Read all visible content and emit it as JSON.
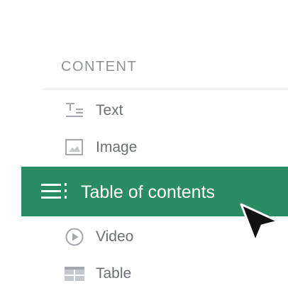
{
  "section": {
    "title": "CONTENT"
  },
  "items": [
    {
      "label": "Text",
      "icon": "text-icon"
    },
    {
      "label": "Image",
      "icon": "image-icon"
    },
    {
      "label": "Table of contents",
      "icon": "table-of-contents-icon",
      "active": true
    },
    {
      "label": "Video",
      "icon": "video-icon"
    },
    {
      "label": "Table",
      "icon": "table-icon"
    }
  ],
  "colors": {
    "accent": "#2a8c63",
    "muted_text": "#6b6f74",
    "header_text": "#8e9297",
    "icon_gray": "#a4a8ad"
  },
  "cursor": {
    "icon": "mouse-pointer-icon"
  }
}
